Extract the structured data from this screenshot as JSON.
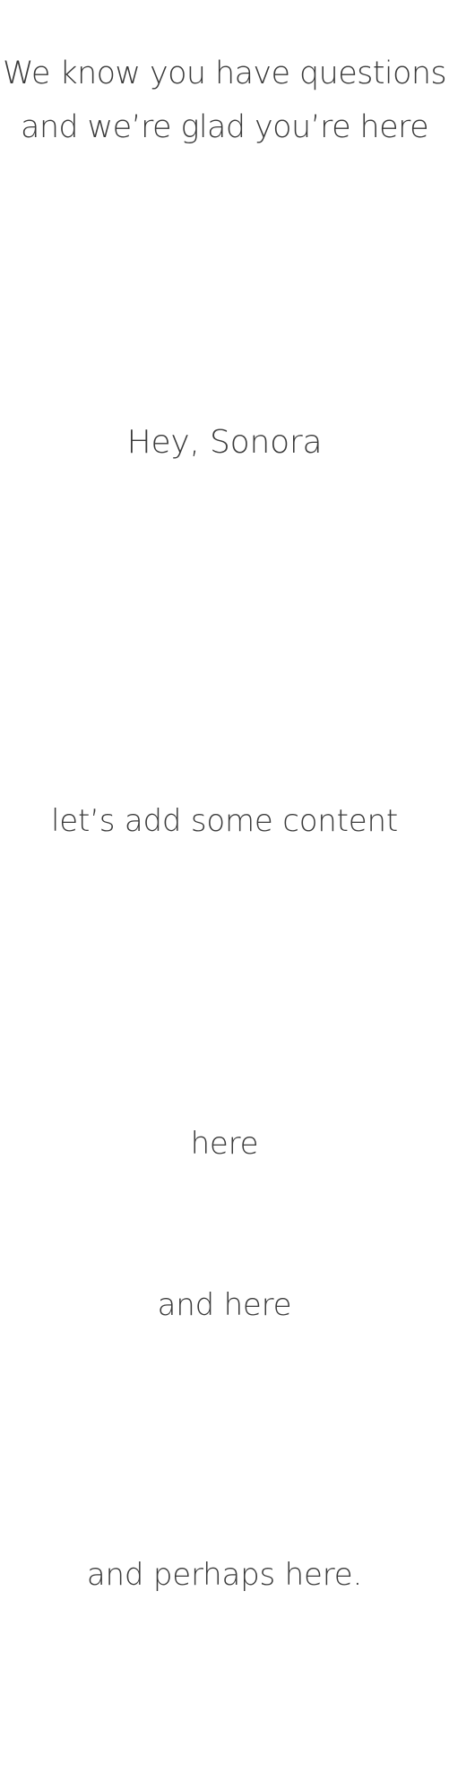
{
  "heading": {
    "line1": "We know you have questions",
    "line2": "and we’re glad you’re here"
  },
  "greeting": "Hey, Sonora",
  "body_lines": {
    "content": "let’s  add some content",
    "here": "here",
    "and_here": "and here",
    "perhaps_here": "and perhaps here."
  }
}
